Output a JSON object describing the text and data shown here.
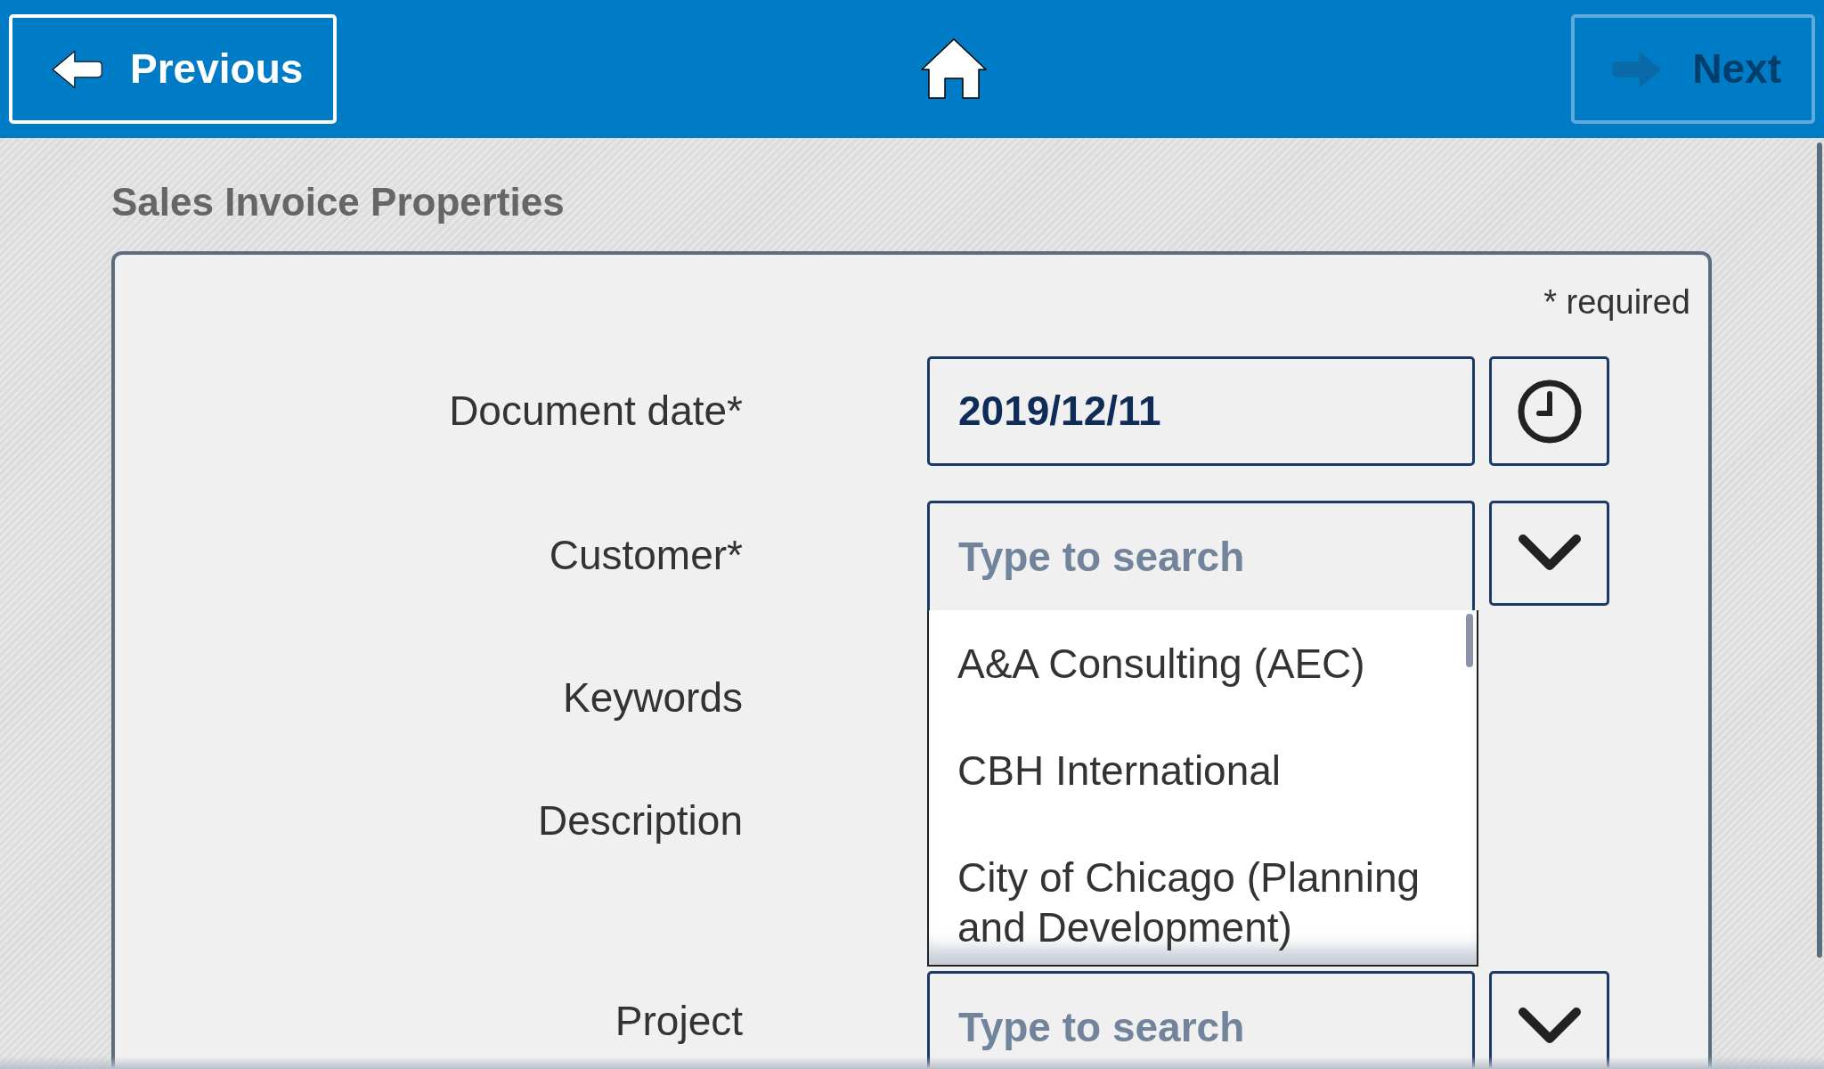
{
  "nav": {
    "previous": {
      "label": "Previous",
      "disabled": false
    },
    "next": {
      "label": "Next",
      "disabled": true
    }
  },
  "title": "Sales Invoice Properties",
  "required_note": "* required",
  "fields": [
    {
      "label": "Document date*",
      "kind": "date",
      "value": "2019/12/11"
    },
    {
      "label": "Customer*",
      "kind": "lookup",
      "placeholder": "Type to search",
      "expanded": true,
      "options": [
        "A&A Consulting (AEC)",
        "CBH International",
        "City of Chicago (Planning and Development)"
      ]
    },
    {
      "label": "Keywords",
      "kind": "text"
    },
    {
      "label": "Description",
      "kind": "textarea"
    },
    {
      "label": "Project",
      "kind": "lookup",
      "placeholder": "Type to search",
      "expanded": false
    }
  ]
}
